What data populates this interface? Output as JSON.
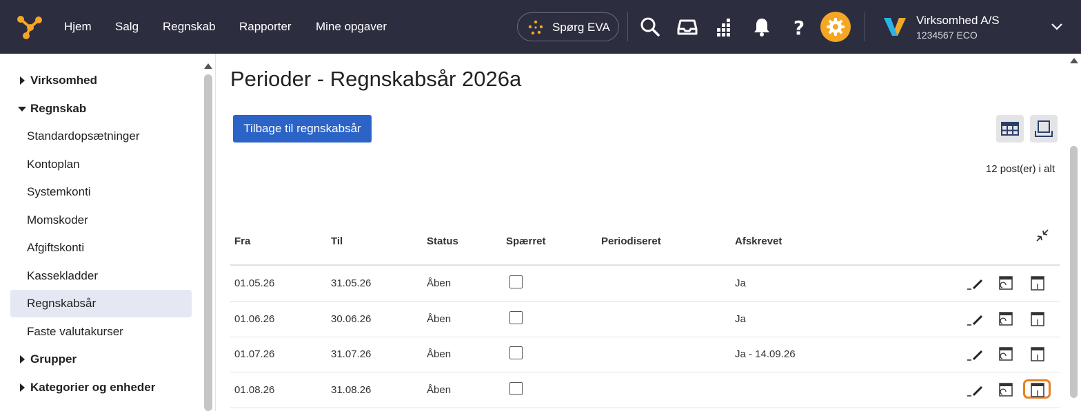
{
  "topbar": {
    "nav": [
      "Hjem",
      "Salg",
      "Regnskab",
      "Rapporter",
      "Mine opgaver"
    ],
    "eva_label": "Spørg EVA",
    "company_name": "Virksomhed A/S",
    "company_sub": "1234567 ECO",
    "accent_color": "#f5a623",
    "bg_color": "#2c2d3f"
  },
  "sidebar": {
    "items": [
      {
        "label": "Virksomhed",
        "type": "group-collapsed"
      },
      {
        "label": "Regnskab",
        "type": "group-expanded"
      },
      {
        "label": "Standardopsætninger",
        "type": "sub"
      },
      {
        "label": "Kontoplan",
        "type": "sub"
      },
      {
        "label": "Systemkonti",
        "type": "sub"
      },
      {
        "label": "Momskoder",
        "type": "sub"
      },
      {
        "label": "Afgiftskonti",
        "type": "sub"
      },
      {
        "label": "Kassekladder",
        "type": "sub"
      },
      {
        "label": "Regnskabsår",
        "type": "sub-active"
      },
      {
        "label": "Faste valutakurser",
        "type": "sub"
      },
      {
        "label": "Grupper",
        "type": "group-collapsed"
      },
      {
        "label": "Kategorier og enheder",
        "type": "group-collapsed"
      }
    ]
  },
  "main": {
    "title": "Perioder - Regnskabsår 2026a",
    "back_button": "Tilbage til regnskabsår",
    "count_text": "12 post(er) i alt",
    "columns": [
      "Fra",
      "Til",
      "Status",
      "Spærret",
      "Periodiseret",
      "Afskrevet"
    ],
    "rows": [
      {
        "fra": "01.05.26",
        "til": "31.05.26",
        "status": "Åben",
        "spaerret": false,
        "periodiseret": "",
        "afskrevet": "Ja"
      },
      {
        "fra": "01.06.26",
        "til": "30.06.26",
        "status": "Åben",
        "spaerret": false,
        "periodiseret": "",
        "afskrevet": "Ja"
      },
      {
        "fra": "01.07.26",
        "til": "31.07.26",
        "status": "Åben",
        "spaerret": false,
        "periodiseret": "",
        "afskrevet": "Ja - 14.09.26"
      },
      {
        "fra": "01.08.26",
        "til": "31.08.26",
        "status": "Åben",
        "spaerret": false,
        "periodiseret": "",
        "afskrevet": ""
      }
    ],
    "row_icons": [
      "edit-icon",
      "reopen-period-icon",
      "close-period-icon"
    ],
    "focus_color": "#e87f1e",
    "button_color": "#2b63c6"
  }
}
